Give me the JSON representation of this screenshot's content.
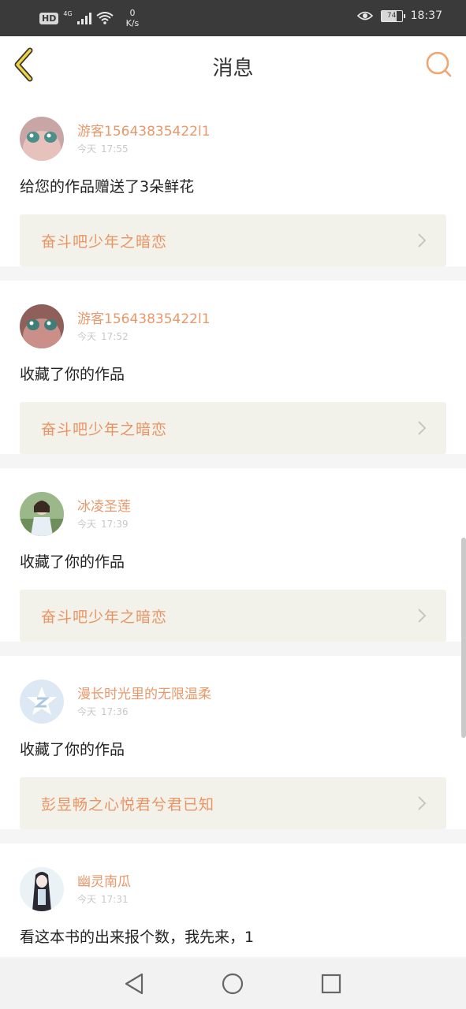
{
  "status_bar": {
    "hd": "HD",
    "network": "4G",
    "speed_value": "0",
    "speed_unit": "K/s",
    "battery": "74",
    "time": "18:37",
    "icons": [
      "signal-icon",
      "wifi-icon",
      "eye-icon",
      "battery-icon"
    ]
  },
  "header": {
    "title": "消息",
    "back_icon": "chevron-left-icon",
    "search_icon": "search-icon",
    "accent": "#f0a470"
  },
  "messages": [
    {
      "user": "游客15643835422l1",
      "day": "今天",
      "time": "17:55",
      "text": "给您的作品赠送了3朵鲜花",
      "work": "奋斗吧少年之暗恋",
      "avatar": "anime-face-avatar"
    },
    {
      "user": "游客15643835422l1",
      "day": "今天",
      "time": "17:52",
      "text": "收藏了你的作品",
      "work": "奋斗吧少年之暗恋",
      "avatar": "anime-face-avatar"
    },
    {
      "user": "冰凌圣莲",
      "day": "今天",
      "time": "17:39",
      "text": "收藏了你的作品",
      "work": "奋斗吧少年之暗恋",
      "avatar": "girl-photo-avatar"
    },
    {
      "user": "漫长时光里的无限温柔",
      "day": "今天",
      "time": "17:36",
      "text": "收藏了你的作品",
      "work": "彭昱畅之心悦君兮君已知",
      "avatar": "default-z-avatar"
    },
    {
      "user": "幽灵南瓜",
      "day": "今天",
      "time": "17:31",
      "text": "看这本书的出来报个数，我先来，1",
      "work": "",
      "avatar": "anime-girl-avatar"
    }
  ],
  "navbar": {
    "icons": [
      "back-triangle-icon",
      "home-circle-icon",
      "recents-square-icon"
    ]
  },
  "colors": {
    "username": "#e8986a",
    "work_title": "#ea9464",
    "work_bg": "#f3f2ea",
    "status_bg": "#3a3a3a"
  }
}
